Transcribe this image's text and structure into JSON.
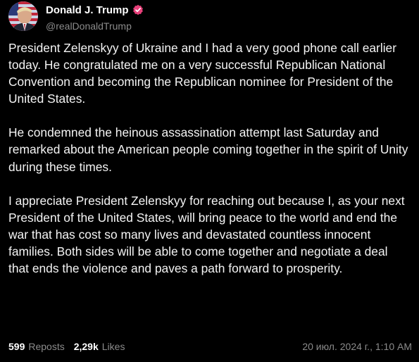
{
  "author": {
    "display_name": "Donald J. Trump",
    "handle": "@realDonaldTrump",
    "verified_icon": "verified-badge-icon",
    "verified_color": "#e8407a"
  },
  "post": {
    "paragraphs": [
      "President Zelenskyy of Ukraine and I had a very good phone call earlier today. He congratulated me on a very successful Republican National Convention and becoming the Republican nominee for President of the United States.",
      "He condemned the heinous assassination attempt last Saturday and remarked about the American people coming together in the spirit of Unity during these times.",
      "I appreciate President Zelenskyy for reaching out because I, as your next President of the United States, will bring peace to the world and end the war that has cost so many lives and devastated countless innocent families. Both sides will be able to come together and negotiate a deal that ends the violence and paves a path forward to prosperity."
    ]
  },
  "stats": {
    "reposts_count": "599",
    "reposts_label": "Reposts",
    "likes_count": "2,29k",
    "likes_label": "Likes"
  },
  "timestamp": "20 июл. 2024 г., 1:10 AM",
  "colors": {
    "background": "#000000",
    "text": "#ffffff",
    "muted": "#8b8b8b"
  }
}
